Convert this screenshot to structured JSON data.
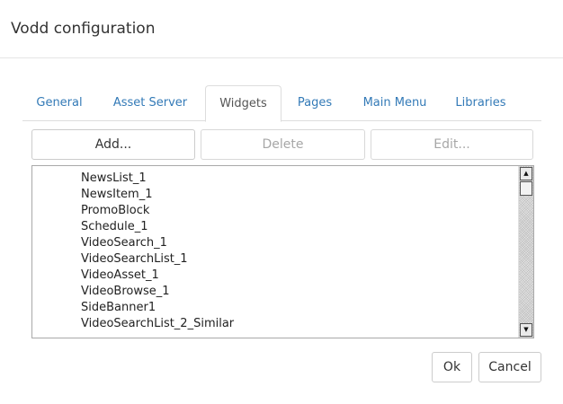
{
  "dialog": {
    "title": "Vodd configuration"
  },
  "tabs": [
    {
      "label": "General"
    },
    {
      "label": "Asset Server"
    },
    {
      "label": "Widgets"
    },
    {
      "label": "Pages"
    },
    {
      "label": "Main Menu"
    },
    {
      "label": "Libraries"
    }
  ],
  "active_tab": "Widgets",
  "toolbar": {
    "add_label": "Add...",
    "delete_label": "Delete",
    "edit_label": "Edit..."
  },
  "widgets_list": {
    "items": [
      "NewsList_1",
      "NewsItem_1",
      "PromoBlock",
      "Schedule_1",
      "VideoSearch_1",
      "VideoSearchList_1",
      "VideoAsset_1",
      "VideoBrowse_1",
      "SideBanner1",
      "VideoSearchList_2_Similar"
    ],
    "scroll_up_icon": "triangle-up-icon",
    "scroll_down_icon": "triangle-down-icon"
  },
  "footer": {
    "ok_label": "Ok",
    "cancel_label": "Cancel"
  },
  "colors": {
    "tab_link": "#337ab7",
    "tab_active_text": "#555555",
    "border": "#cccccc"
  }
}
